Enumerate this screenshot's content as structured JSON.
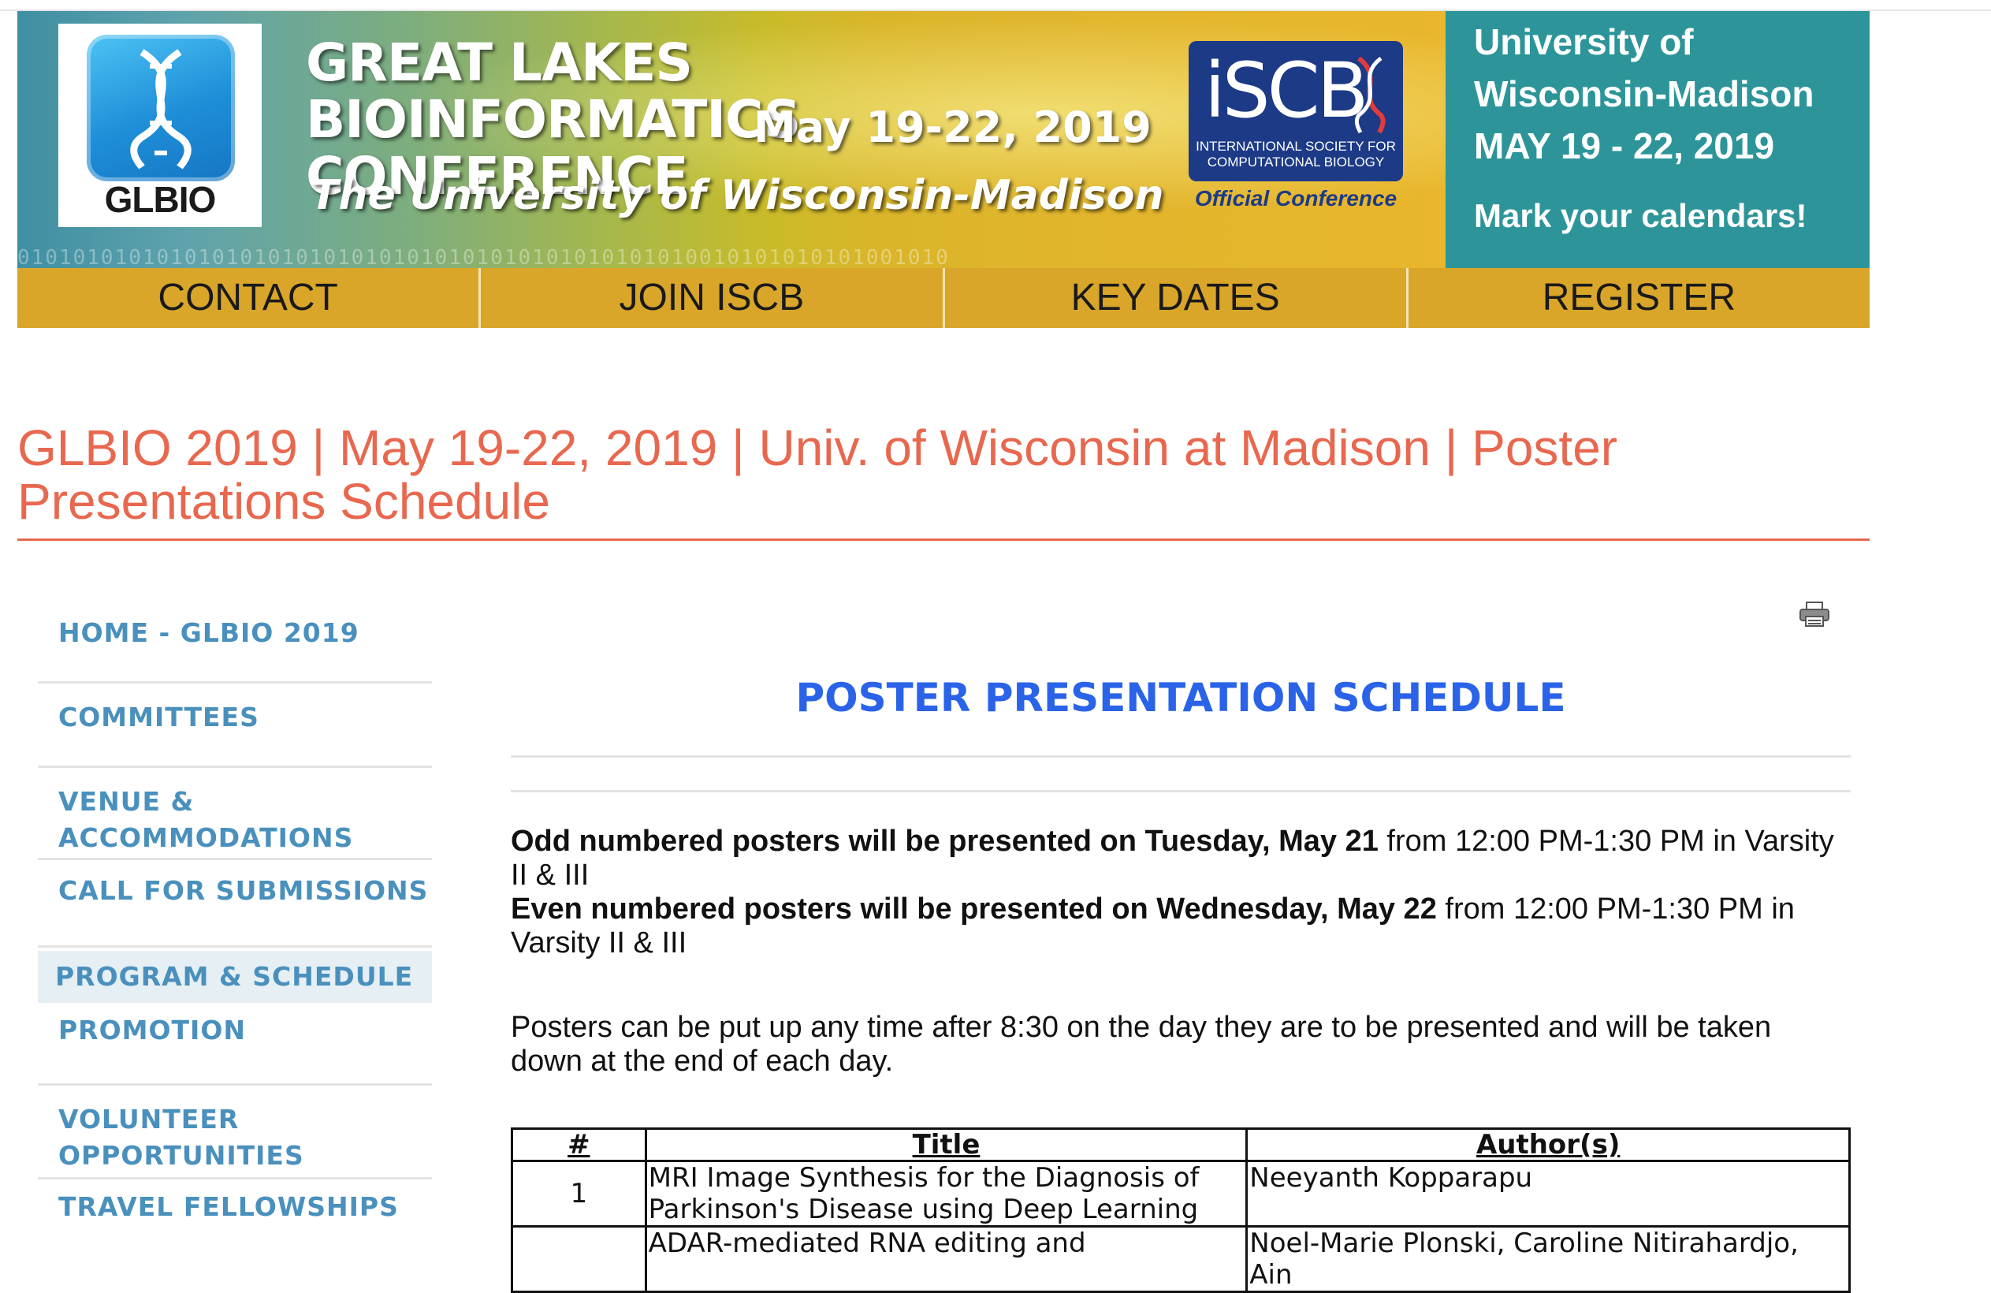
{
  "banner": {
    "logo_text": "GLBIO",
    "title_line1": "GREAT LAKES BIOINFORMATICS",
    "title_line2": "CONFERENCE",
    "dates": "May 19-22, 2019",
    "university": "The University of Wisconsin-Madison",
    "iscb_mark": "iSCB",
    "iscb_subtitle_line1": "INTERNATIONAL SOCIETY FOR",
    "iscb_subtitle_line2": "COMPUTATIONAL BIOLOGY",
    "iscb_official": "Official Conference",
    "side_line1": "University of",
    "side_line2": "Wisconsin-Madison",
    "side_line3": "MAY 19 - 22, 2019",
    "side_cta": "Mark your calendars!",
    "colors": {
      "teal": "#2d9599",
      "nav_gold": "#d9a62a",
      "iscb_navy": "#1c3a86"
    }
  },
  "nav": [
    "CONTACT",
    "JOIN ISCB",
    "KEY DATES",
    "REGISTER"
  ],
  "page_title": "GLBIO 2019 | May 19-22, 2019 | Univ. of Wisconsin at Madison | Poster Presentations Schedule",
  "sidebar": [
    {
      "label": "HOME - GLBIO 2019"
    },
    {
      "label": "COMMITTEES"
    },
    {
      "label": "VENUE & ACCOMMODATIONS"
    },
    {
      "label": "CALL FOR SUBMISSIONS"
    },
    {
      "label": "PROGRAM & SCHEDULE",
      "active": true
    },
    {
      "label": "PROMOTION"
    },
    {
      "label": "VOLUNTEER OPPORTUNITIES"
    },
    {
      "label": "TRAVEL FELLOWSHIPS"
    }
  ],
  "main": {
    "print_icon": "printer-icon",
    "heading": "POSTER PRESENTATION SCHEDULE",
    "odd_bold": "Odd numbered posters will be presented on Tuesday, May 21",
    "odd_rest": " from 12:00 PM-1:30 PM in Varsity II & III",
    "even_bold": "Even numbered posters will be presented on Wednesday, May 22",
    "even_rest": " from 12:00 PM-1:30 PM in Varsity II & III",
    "posters_note": "Posters can be put up any time after 8:30 on the day they are to be presented and will be taken down at the end of each day.",
    "table": {
      "headers": [
        "#",
        "Title",
        "Author(s)"
      ],
      "rows": [
        {
          "num": "1",
          "title": "MRI Image Synthesis for the Diagnosis of Parkinson's Disease using Deep Learning",
          "authors": "Neeyanth Kopparapu"
        },
        {
          "num": "",
          "title": "ADAR-mediated RNA editing and",
          "authors": "Noel-Marie Plonski, Caroline Nitirahardjo, Ain"
        }
      ]
    },
    "accent_color": "#2a63e8",
    "title_color": "#e8684f"
  }
}
